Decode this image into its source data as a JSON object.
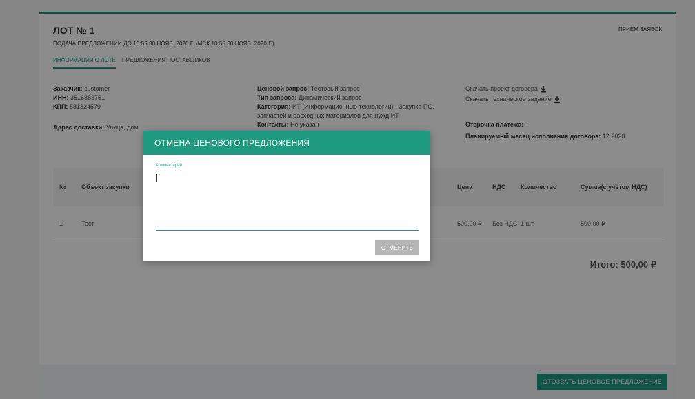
{
  "lot": {
    "title": "ЛОТ № 1",
    "deadline": "Подача предложений до 10:55 30 нояб. 2020 г. (МСК 10:55 30 нояб. 2020 г.)",
    "status": "Прием заявок"
  },
  "tabs": [
    {
      "label": "Информация о лоте",
      "active": true
    },
    {
      "label": "Предложения поставщиков",
      "active": false
    }
  ],
  "customer": {
    "customer_label": "Заказчик:",
    "customer_value": "customer",
    "inn_label": "ИНН:",
    "inn_value": "3516883751",
    "kpp_label": "КПП:",
    "kpp_value": "581324579",
    "address_label": "Адрес доставки:",
    "address_value": "Улица, дом"
  },
  "request": {
    "price_request_label": "Ценовой запрос:",
    "price_request_value": "Тестовый запрос",
    "type_label": "Тип запроса:",
    "type_value": "Динамический запрос",
    "category_label": "Категория:",
    "category_value": "ИТ (Информационные технологии) - Закупка ПО, запчастей и расходных материалов для нужд ИТ",
    "contacts_label": "Контакты:",
    "contacts_value": "Не указан"
  },
  "documents": {
    "download_contract": "Скачать проект договора",
    "download_spec": "Скачать техническое задание",
    "deferral_label": "Отсрочка платежа:",
    "deferral_value": "-",
    "month_label": "Планируемый месяц исполнения договора:",
    "month_value": "12.2020"
  },
  "table": {
    "headers": {
      "num": "№",
      "object": "Объект закупки",
      "price": "Цена",
      "vat": "НДС",
      "qty": "Количество",
      "sum": "Сумма(с учётом НДС)"
    },
    "rows": [
      {
        "num": "1",
        "object": "Тест",
        "price": "500,00 ₽",
        "vat": "Без НДС",
        "qty": "1 шт.",
        "sum": "500,00 ₽"
      }
    ],
    "total": "Итого: 500,00 ₽"
  },
  "footer": {
    "withdraw_label": "Отозвать ценовое предложение"
  },
  "modal": {
    "title": "Отмена ценового предложения",
    "comment_label": "Комментарий",
    "comment_value": "",
    "cancel_label": "Отменить"
  },
  "colors": {
    "accent": "#1e9a80",
    "overlay": "rgba(0,0,0,0.45)",
    "disabled_button": "#b5b5b5"
  }
}
